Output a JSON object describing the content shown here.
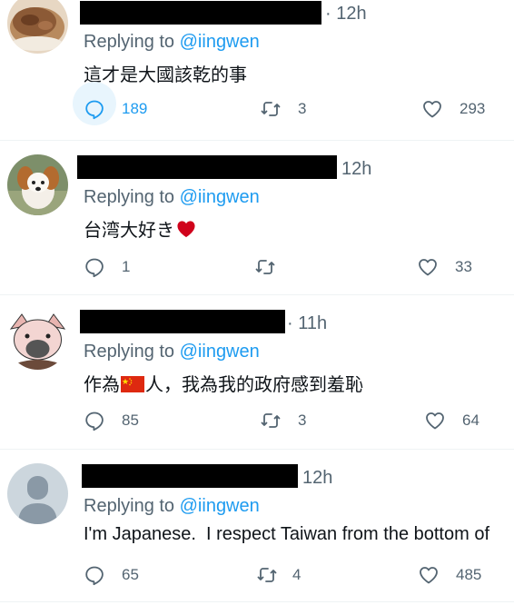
{
  "tweets": [
    {
      "time": "· 12h",
      "replying_prefix": "Replying to",
      "handle": "@iingwen",
      "text": "這才是大國該乾的事",
      "replies": "189",
      "retweets": "3",
      "likes": "293",
      "avatar": "food-photo"
    },
    {
      "time": "12h",
      "replying_prefix": "Replying to",
      "handle": "@iingwen",
      "text": "台湾大好き",
      "text_suffix_icon": "red-heart-emoji",
      "replies": "1",
      "retweets": "",
      "likes": "33",
      "avatar": "dog-photo"
    },
    {
      "time": "· 11h",
      "replying_prefix": "Replying to",
      "handle": "@iingwen",
      "text_before_flag": "作為",
      "flag_icon": "china-flag-emoji",
      "text_after_flag": "人，我為我的政府感到羞恥",
      "replies": "85",
      "retweets": "3",
      "likes": "64",
      "avatar": "pig-cartoon"
    },
    {
      "time": "12h",
      "replying_prefix": "Replying to",
      "handle": "@iingwen",
      "text": "I'm Japanese.  I respect Taiwan from the bottom of",
      "replies": "65",
      "retweets": "4",
      "likes": "485",
      "avatar": "default-profile"
    }
  ],
  "colors": {
    "link": "#1d9bf0",
    "muted": "#536471",
    "text": "#0f1419",
    "heart_emoji": "#d0021b"
  }
}
